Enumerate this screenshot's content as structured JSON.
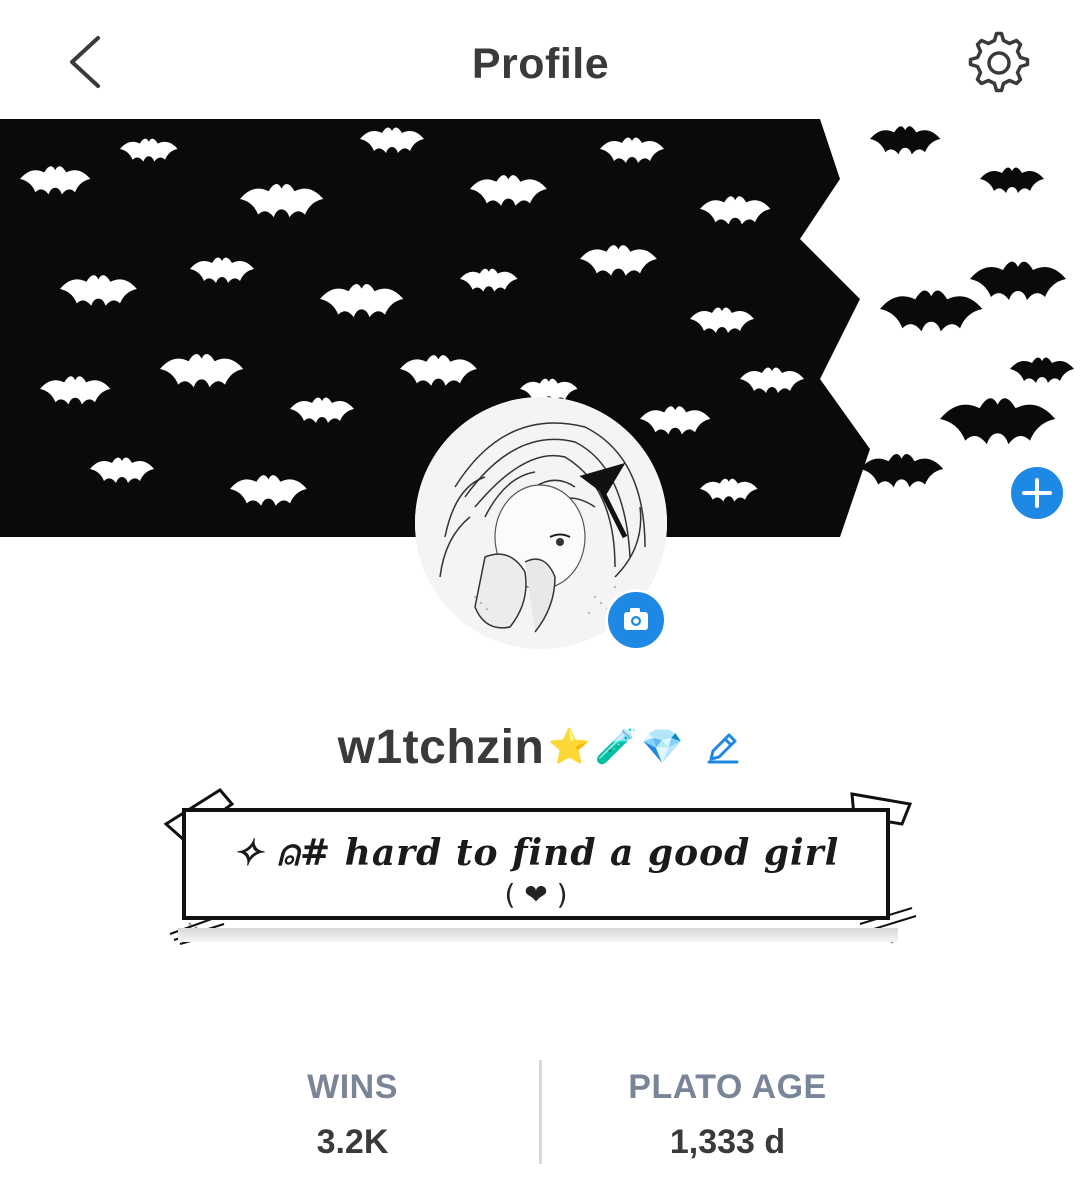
{
  "header": {
    "title": "Profile",
    "back_icon": "chevron-left-icon",
    "settings_icon": "gear-icon"
  },
  "banner": {
    "add_icon": "plus-icon",
    "accent": "#1e88e5"
  },
  "avatar": {
    "camera_icon": "camera-icon"
  },
  "profile": {
    "username": "w1tchzin",
    "username_emojis": [
      "⭐",
      "🧪",
      "💎"
    ],
    "edit_icon": "pencil-icon"
  },
  "bio": {
    "line1": "✧ ⍝# hard to find a good girl",
    "line2": "( ❤ )"
  },
  "stats": [
    {
      "label": "WINS",
      "value": "3.2K"
    },
    {
      "label": "PLATO AGE",
      "value": "1,333 d"
    }
  ],
  "colors": {
    "accent": "#1e88e5",
    "label": "#7b8598",
    "text": "#3a3a3a"
  }
}
